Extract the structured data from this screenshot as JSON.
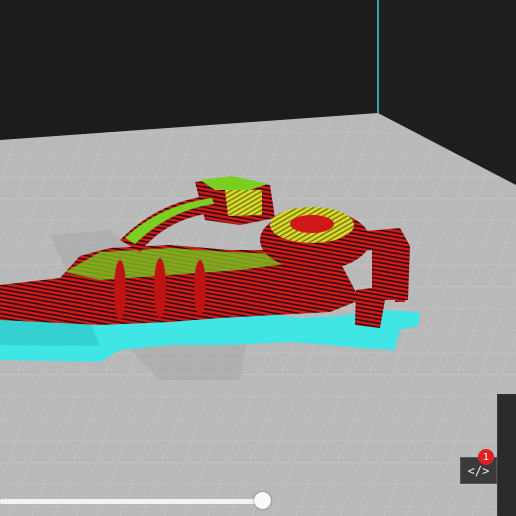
{
  "viewer": {
    "background_color": "#1e1e1e",
    "bed_color": "#b9b9b9",
    "wall_color": "#1c1c1c",
    "accent_edge_color": "#2fa6a6"
  },
  "model": {
    "perimeter_color": "#e01f1f",
    "infill_color": "#d8d82a",
    "top_color": "#7ad020",
    "support_color": "#40e6e6"
  },
  "layer_slider": {
    "value_fraction": 1.0
  },
  "toolbar": {
    "gcode_icon": "code-icon",
    "gcode_label": "</>",
    "badge_count": "1",
    "badge_color": "#e02020"
  }
}
